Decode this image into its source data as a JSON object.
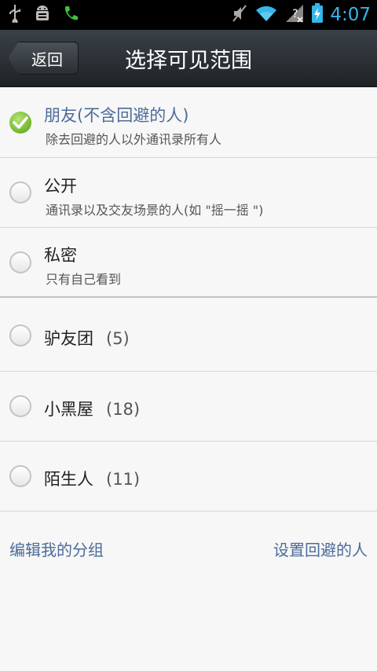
{
  "status_bar": {
    "time": "4:07",
    "icons": [
      "usb-icon",
      "android-debug-icon",
      "phone-icon",
      "mute-icon",
      "wifi-icon",
      "no-signal-icon",
      "battery-charging-icon"
    ]
  },
  "header": {
    "back_label": "返回",
    "title": "选择可见范围"
  },
  "options": [
    {
      "title": "朋友(不含回避的人)",
      "subtitle": "除去回避的人以外通讯录所有人",
      "selected": true
    },
    {
      "title": "公开",
      "subtitle": "通讯录以及交友场景的人(如 \"摇一摇 \")",
      "selected": false
    },
    {
      "title": "私密",
      "subtitle": "只有自己看到",
      "selected": false
    }
  ],
  "groups": [
    {
      "name": "驴友团",
      "count": "(5)"
    },
    {
      "name": "小黑屋",
      "count": "(18)"
    },
    {
      "name": "陌生人",
      "count": "(11)"
    }
  ],
  "footer": {
    "edit_groups": "编辑我的分组",
    "set_avoid": "设置回避的人"
  },
  "colors": {
    "accent_link": "#4c6b9a",
    "check_green": "#6fb52a",
    "time_blue": "#35b6e8"
  }
}
